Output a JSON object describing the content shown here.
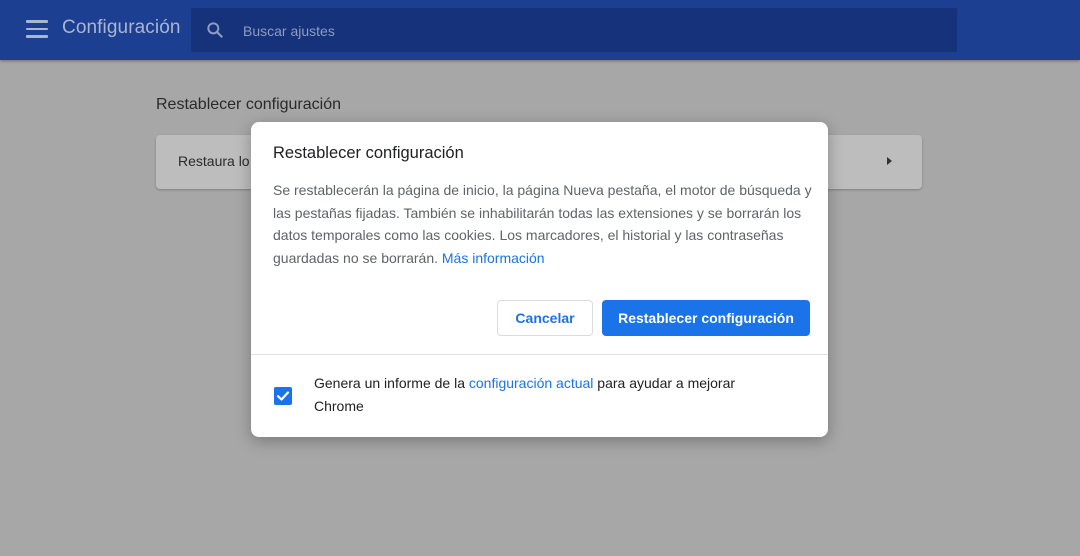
{
  "header": {
    "title": "Configuración",
    "search_placeholder": "Buscar ajustes"
  },
  "page": {
    "section_heading": "Restablecer configuración",
    "card_label": "Restaura lo"
  },
  "dialog": {
    "title": "Restablecer configuración",
    "body": "Se restablecerán la página de inicio, la página Nueva pestaña, el motor de búsqueda y las pestañas fijadas. También se inhabilitarán todas las extensiones y se borrarán los datos temporales como las cookies. Los marcadores, el historial y las contraseñas guardadas no se borrarán.",
    "more_info_link": "Más información",
    "cancel_label": "Cancelar",
    "reset_label": "Restablecer configuración",
    "report": {
      "checked": true,
      "text_before": "Genera un informe de la",
      "link": "configuración actual",
      "text_after": "para ayudar a mejorar Chrome"
    }
  },
  "colors": {
    "header_bg": "#1d3f91",
    "accent": "#1a73e8"
  },
  "icons": {
    "menu": "hamburger-menu-icon",
    "search": "search-icon",
    "card_arrow": "caret-right-icon",
    "checkbox": "check-icon"
  }
}
